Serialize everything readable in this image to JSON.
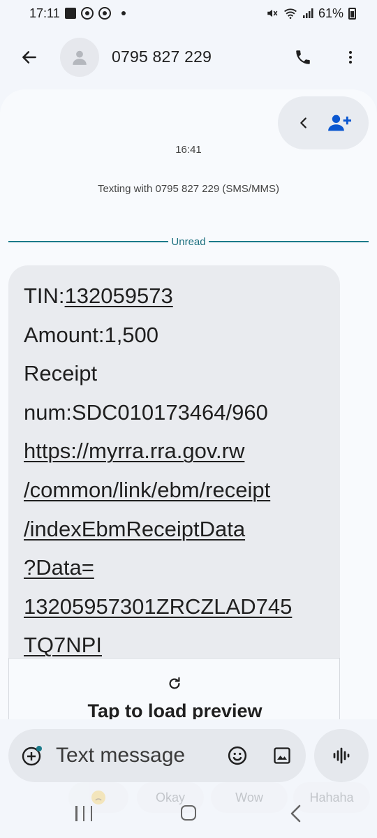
{
  "status_bar": {
    "time": "17:11",
    "battery": "61%"
  },
  "header": {
    "contact": "0795 827 229"
  },
  "conversation": {
    "time": "16:41",
    "texting_with": "Texting with 0795 827 229 (SMS/MMS)",
    "unread_label": "Unread"
  },
  "message": {
    "tin_label": "TIN:",
    "tin_value": "132059573",
    "amount": "Amount:1,500",
    "receipt_line1": "Receipt",
    "receipt_line2": "num:SDC010173464/960",
    "link_lines": [
      "https://myrra.rra.gov.rw",
      "/common/link/ebm/receipt",
      "/indexEbmReceiptData",
      "?Data=",
      "13205957301ZRCZLAD745",
      "TQ7NPI"
    ],
    "preview_label": "Tap to load preview"
  },
  "composer": {
    "placeholder": "Text message"
  },
  "smart_replies": [
    "Okay",
    "Wow",
    "Hahaha"
  ],
  "colors": {
    "accent": "#1b7a8a",
    "icon_blue": "#0b57d0",
    "bubble": "#e9ebef"
  },
  "icons": [
    "back-arrow-icon",
    "person-icon",
    "phone-icon",
    "more-vert-icon",
    "chevron-left-icon",
    "person-add-icon",
    "refresh-icon",
    "add-circle-icon",
    "emoji-icon",
    "gallery-icon",
    "voice-wave-icon"
  ]
}
